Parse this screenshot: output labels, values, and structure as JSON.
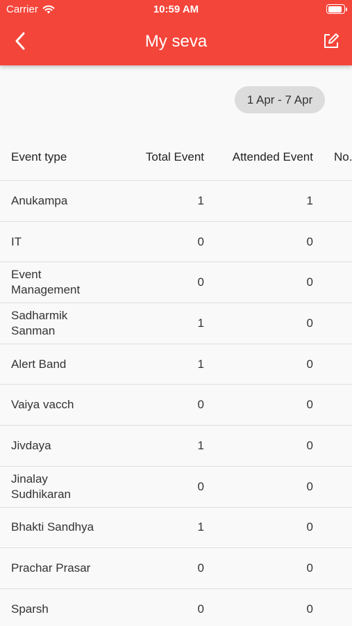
{
  "status_bar": {
    "carrier": "Carrier",
    "time": "10:59 AM",
    "battery_level": 0.9
  },
  "header": {
    "title": "My seva",
    "back_icon": "chevron-left-icon",
    "edit_icon": "edit-icon"
  },
  "colors": {
    "header_bg": "#f4453a",
    "chip_bg": "#dcdcdc"
  },
  "date_range": "1 Apr - 7 Apr",
  "table": {
    "columns": [
      "Event type",
      "Total Event",
      "Attended Event",
      "No."
    ],
    "rows": [
      {
        "type": "Anukampa",
        "total": "1",
        "attended": "1"
      },
      {
        "type": "IT",
        "total": "0",
        "attended": "0"
      },
      {
        "type": "Event Management",
        "total": "0",
        "attended": "0"
      },
      {
        "type": "Sadharmik Sanman",
        "total": "1",
        "attended": "0"
      },
      {
        "type": "Alert Band",
        "total": "1",
        "attended": "0"
      },
      {
        "type": "Vaiya vacch",
        "total": "0",
        "attended": "0"
      },
      {
        "type": "Jivdaya",
        "total": "1",
        "attended": "0"
      },
      {
        "type": "Jinalay Sudhikaran",
        "total": "0",
        "attended": "0"
      },
      {
        "type": "Bhakti Sandhya",
        "total": "1",
        "attended": "0"
      },
      {
        "type": "Prachar Prasar",
        "total": "0",
        "attended": "0"
      },
      {
        "type": "Sparsh",
        "total": "0",
        "attended": "0"
      }
    ]
  }
}
